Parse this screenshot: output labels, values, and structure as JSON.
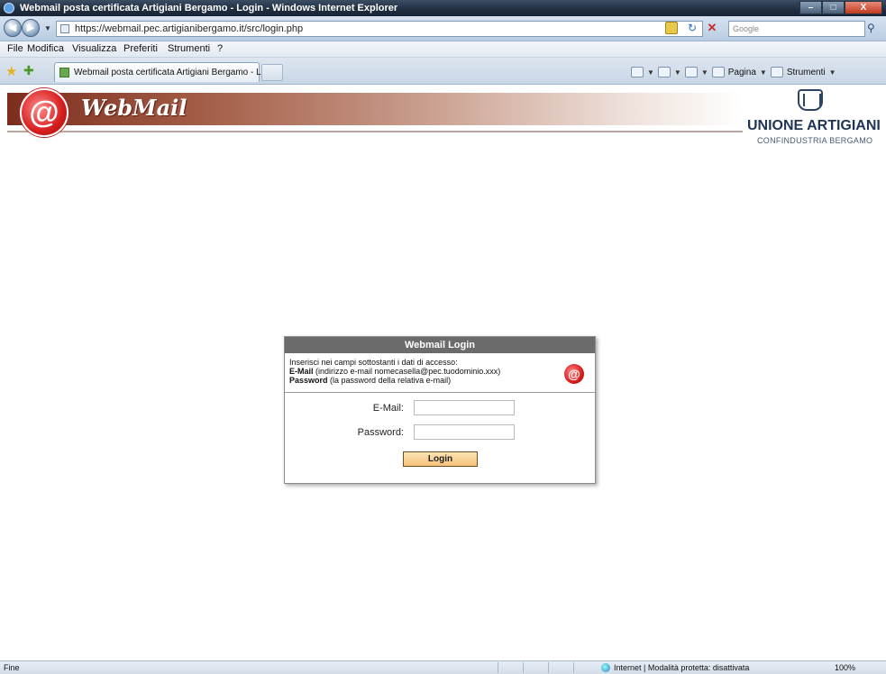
{
  "window": {
    "title": "Webmail posta certificata Artigiani Bergamo - Login - Windows Internet Explorer",
    "min_glyph": "–",
    "max_glyph": "□",
    "close_glyph": "X"
  },
  "address": {
    "url": "https://webmail.pec.artigianibergamo.it/src/login.php",
    "search_placeholder": "Google"
  },
  "menu": {
    "items": [
      "File",
      "Modifica",
      "Visualizza",
      "Preferiti",
      "Strumenti",
      "?"
    ]
  },
  "tabs": {
    "active_tab": "Webmail posta certificata Artigiani Bergamo - Lo..."
  },
  "command_bar": {
    "page_label": "Pagina",
    "tools_label": "Strumenti"
  },
  "banner": {
    "title": "WebMail",
    "seal_glyph": "@",
    "org_name": "UNIONE ARTIGIANI",
    "org_sub": "CONFINDUSTRIA BERGAMO"
  },
  "login": {
    "header": "Webmail Login",
    "intro": "Inserisci nei campi sottostanti i dati di accesso:",
    "email_hint_label": "E-Mail",
    "email_hint_text": "(indirizzo e-mail nomecasella@pec.tuodominio.xxx)",
    "password_hint_label": "Password",
    "password_hint_text": "(la password della relativa e-mail)",
    "email_label": "E-Mail:",
    "email_value": "",
    "password_label": "Password:",
    "password_value": "",
    "button_label": "Login"
  },
  "status": {
    "left": "Fine",
    "zone": "Internet | Modalità protetta: disattivata",
    "zoom": "100%"
  },
  "colors": {
    "banner_dark": "#7b2e1e",
    "login_header": "#6b6b6b",
    "login_button": "#f5c27a",
    "seal_red": "#d71d1d",
    "org_text": "#1f3556"
  }
}
